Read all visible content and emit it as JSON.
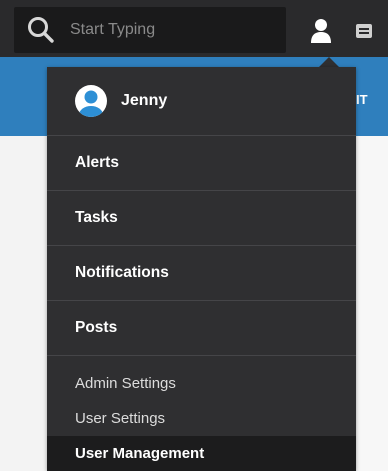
{
  "search": {
    "placeholder": "Start Typing",
    "icon": "search-icon"
  },
  "topbar": {
    "user_icon": "user-icon",
    "menu_icon": "menu-icon"
  },
  "blue_bar": {
    "partial_text": "IT"
  },
  "profile": {
    "name": "Jenny",
    "avatar_icon": "avatar-icon"
  },
  "menu": {
    "items": [
      {
        "label": "Alerts"
      },
      {
        "label": "Tasks"
      },
      {
        "label": "Notifications"
      },
      {
        "label": "Posts"
      }
    ],
    "settings": [
      {
        "label": "Admin Settings"
      },
      {
        "label": "User Settings"
      },
      {
        "label": "User Management",
        "active": true
      }
    ]
  },
  "colors": {
    "topbar": "#2a2a2c",
    "accent_blue": "#2f7fbd",
    "dropdown_bg": "#2f2f31",
    "active_item_bg": "#1c1c1d",
    "avatar_blue": "#2d8fd5"
  }
}
